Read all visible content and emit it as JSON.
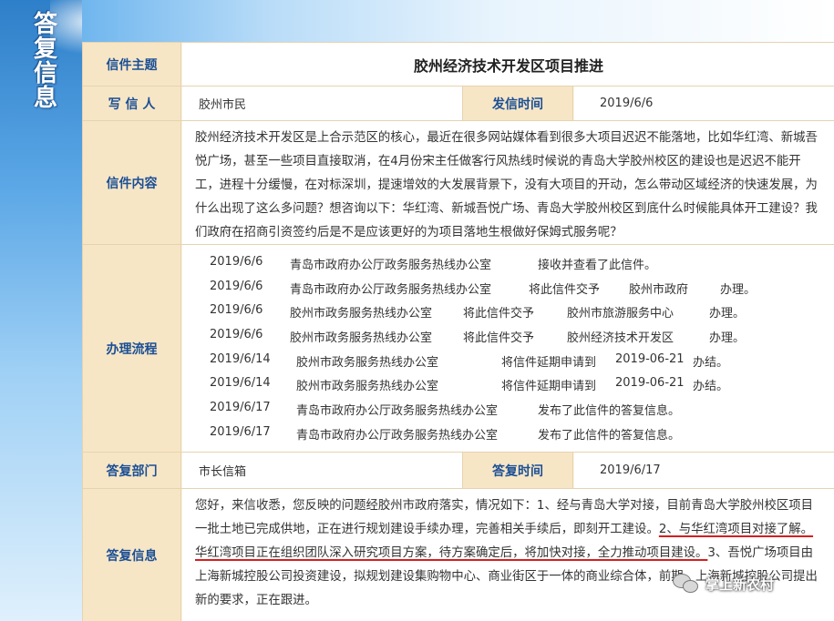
{
  "banner": {
    "title_chars": [
      "答",
      "复",
      "信",
      "息"
    ]
  },
  "subject": {
    "label": "信件主题",
    "value": "胶州经济技术开发区项目推进"
  },
  "writer": {
    "label": "写 信 人",
    "value": "胶州市民",
    "time_label": "发信时间",
    "time_value": "2019/6/6"
  },
  "content": {
    "label": "信件内容",
    "text": "胶州经济技术开发区是上合示范区的核心，最近在很多网站媒体看到很多大项目迟迟不能落地，比如华红湾、新城吾悦广场，甚至一些项目直接取消，在4月份宋主任做客行风热线时候说的青岛大学胶州校区的建设也是迟迟不能开工，进程十分缓慢，在对标深圳，提速增效的大发展背景下，没有大项目的开动，怎么带动区域经济的快速发展，为什么出现了这么多问题？想咨询以下：华红湾、新城吾悦广场、青岛大学胶州校区到底什么时候能具体开工建设？我们政府在招商引资签约后是不是应该更好的为项目落地生根做好保姆式服务呢？"
  },
  "process": {
    "label": "办理流程",
    "rows": [
      {
        "date": "2019/6/6",
        "dept": "青岛市政府办公厅政务服务热线办公室",
        "action": "接收并查看了此信件。",
        "target": "",
        "suffix": ""
      },
      {
        "date": "2019/6/6",
        "dept": "青岛市政府办公厅政务服务热线办公室",
        "action": "将此信件交予",
        "target": "胶州市政府",
        "suffix": "办理。"
      },
      {
        "date": "2019/6/6",
        "dept": "胶州市政务服务热线办公室",
        "action": "将此信件交予",
        "target": "胶州市旅游服务中心",
        "suffix": "办理。"
      },
      {
        "date": "2019/6/6",
        "dept": "胶州市政务服务热线办公室",
        "action": "将此信件交予",
        "target": "胶州经济技术开发区",
        "suffix": "办理。"
      },
      {
        "date": "2019/6/14",
        "dept": "胶州市政务服务热线办公室",
        "action": "将信件延期申请到",
        "target": "2019-06-21",
        "suffix": "办结。"
      },
      {
        "date": "2019/6/14",
        "dept": "胶州市政务服务热线办公室",
        "action": "将信件延期申请到",
        "target": "2019-06-21",
        "suffix": "办结。"
      },
      {
        "date": "2019/6/17",
        "dept": "青岛市政府办公厅政务服务热线办公室",
        "action": "发布了此信件的答复信息。",
        "target": "",
        "suffix": ""
      },
      {
        "date": "2019/6/17",
        "dept": "青岛市政府办公厅政务服务热线办公室",
        "action": "发布了此信件的答复信息。",
        "target": "",
        "suffix": ""
      }
    ]
  },
  "reply_dept": {
    "label": "答复部门",
    "value": "市长信箱",
    "time_label": "答复时间",
    "time_value": "2019/6/17"
  },
  "reply": {
    "label": "答复信息",
    "part1": "您好，来信收悉，您反映的问题经胶州市政府落实，情况如下：1、经与青岛大学对接，目前青岛大学胶州校区项目一批土地已完成供地，正在进行规划建设手续办理，完善相关手续后，即刻开工建设。",
    "part2": "2、与华红湾项目对接了解。华红湾项目正在组织团队深入研究项目方案，待方案确定后，将加快对接，全力推动项目建设。",
    "part3": "3、吾悦广场项目由上海新城控股公司投资建设，拟规划建设集购物中心、商业街区于一体的商业综合体，前期，上海新城控股公司提出新的要求，正在跟进。"
  },
  "watermark": {
    "text": "掌上新农村"
  }
}
